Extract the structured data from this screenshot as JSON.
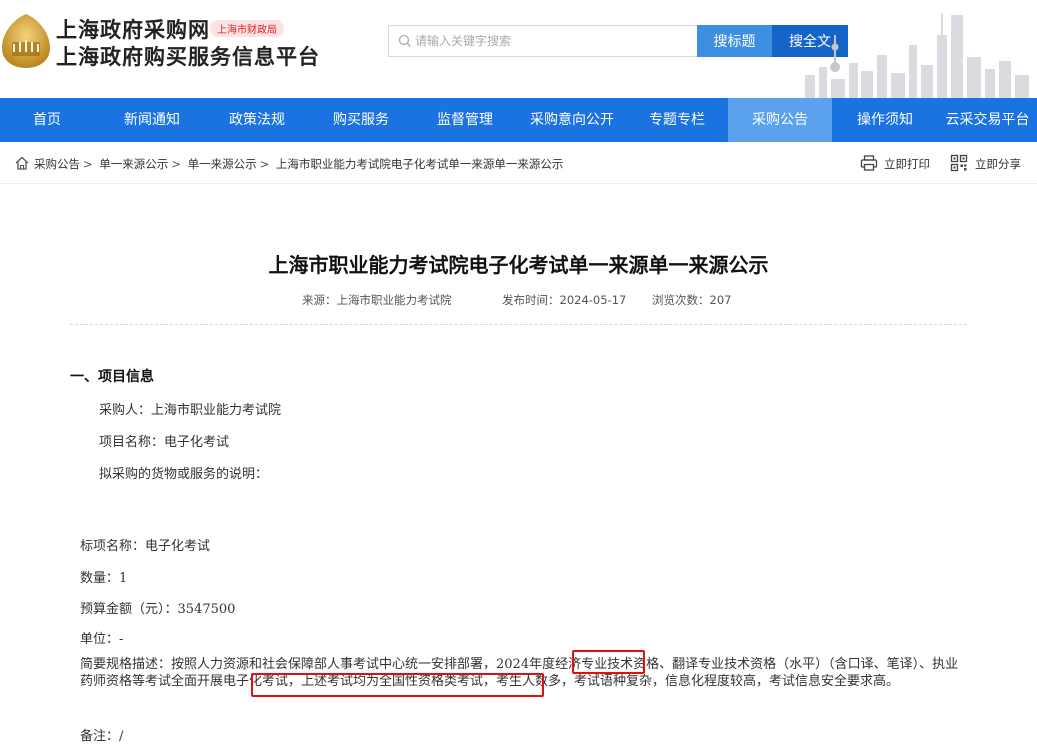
{
  "header": {
    "brand_line1": "上海政府采购网",
    "brand_badge": "上海市财政局",
    "brand_line2": "上海政府购买服务信息平台",
    "search_placeholder": "请输入关键字搜索",
    "search_title_btn": "搜标题",
    "search_full_btn": "搜全文"
  },
  "nav": {
    "items": [
      "首页",
      "新闻通知",
      "政策法规",
      "购买服务",
      "监督管理",
      "采购意向公开",
      "专题专栏",
      "采购公告",
      "操作须知",
      "云采交易平台"
    ],
    "active_index": 7
  },
  "breadcrumb": {
    "items": [
      "采购公告",
      "单一来源公示",
      "单一来源公示",
      "上海市职业能力考试院电子化考试单一来源单一来源公示"
    ],
    "print_label": "立即打印",
    "share_label": "立即分享"
  },
  "article": {
    "title": "上海市职业能力考试院电子化考试单一来源单一来源公示",
    "source": "来源：上海市职业能力考试院",
    "publish_time": "发布时间：2024-05-17",
    "views": "浏览次数：207",
    "section1_heading": "一、项目信息",
    "purchaser": "采购人：上海市职业能力考试院",
    "project_name": "项目名称：电子化考试",
    "goods_desc": "拟采购的货物或服务的说明：",
    "lot_name": "标项名称：电子化考试",
    "quantity": "数量：1",
    "budget": "预算金额（元）：3547500",
    "unit": "单位：-",
    "spec_desc": "简要规格描述：按照人力资源和社会保障部人事考试中心统一安排部署，2024年度经济专业技术资格、翻译专业技术资格（水平）（含口译、笔译）、执业药师资格等考试全面开展电子化考试，上述考试均为全国性资格类考试，考生人数多，考试语种复杂，信息化程度较高，考试信息安全要求高。",
    "remarks": "备注：/"
  },
  "colors": {
    "nav_bg": "#1a73e1",
    "nav_active": "#5aa2ee",
    "highlight_border": "#e01010"
  }
}
